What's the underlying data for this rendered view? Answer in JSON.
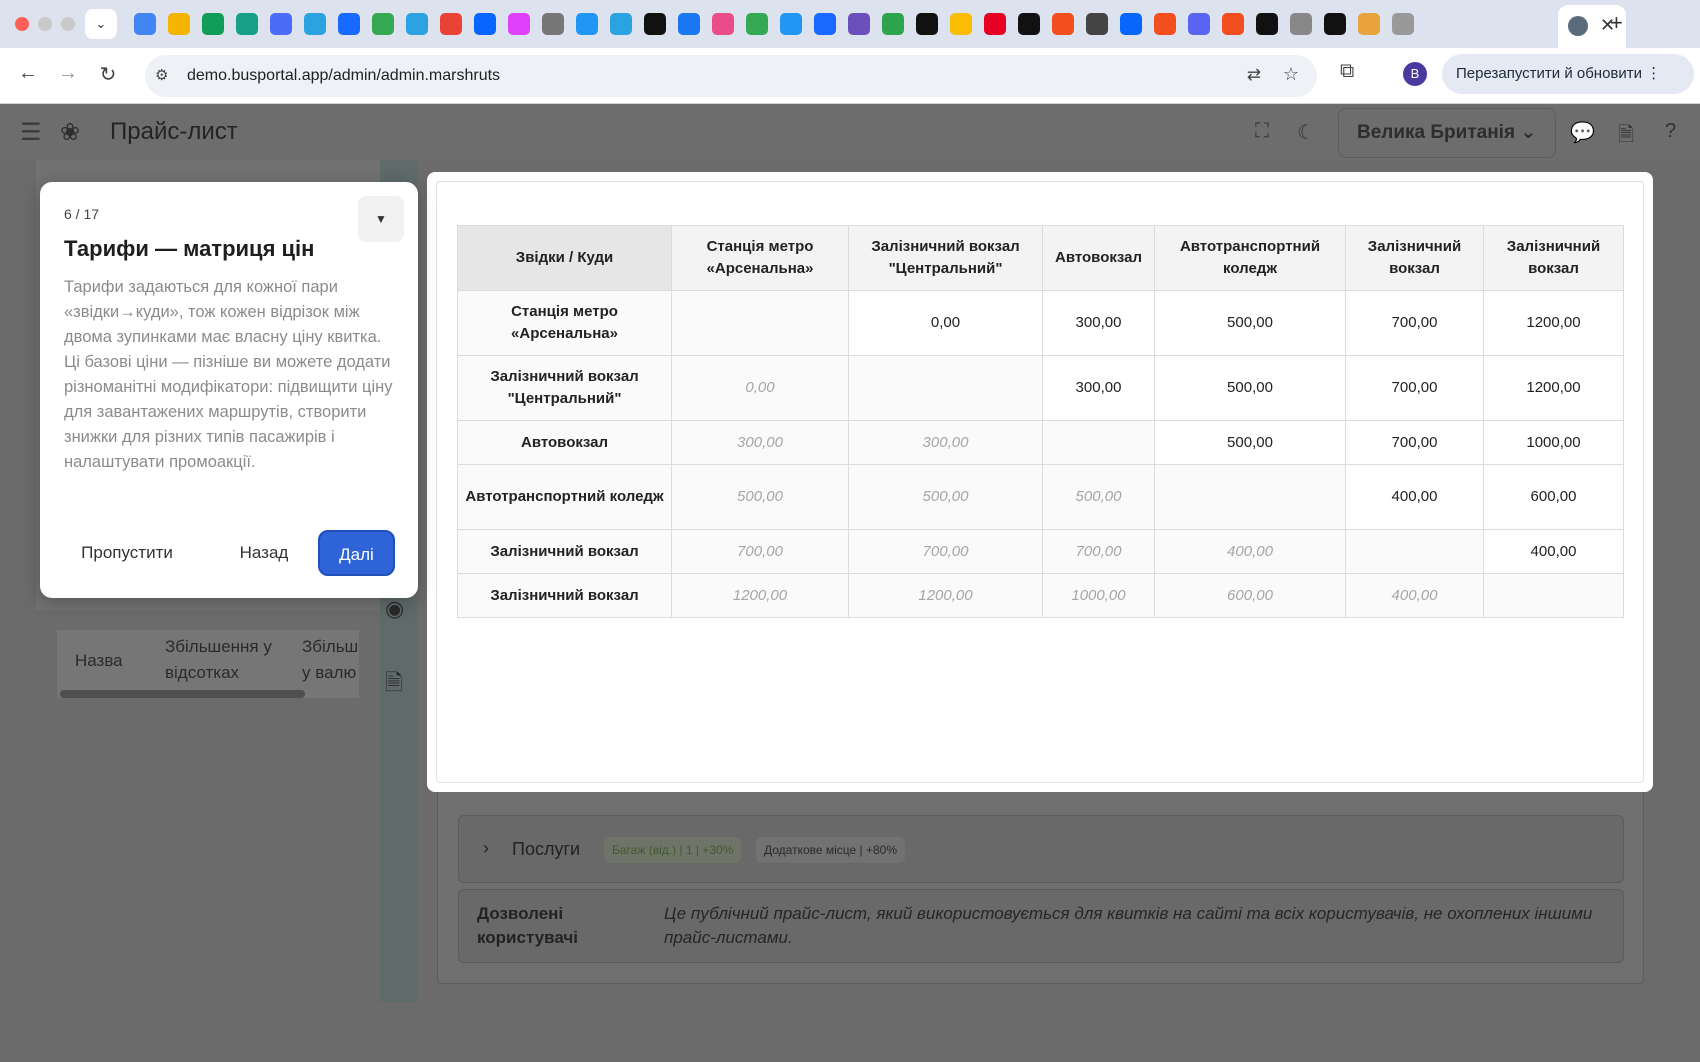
{
  "browser": {
    "url": "demo.busportal.app/admin/admin.marshruts",
    "relaunch_label": "Перезапустити й обновити",
    "profile_initial": "B",
    "tab_dropdown": "⌄",
    "new_tab": "+",
    "close_tab": "✕",
    "favicon_colors": [
      "#4285f4",
      "#f4b400",
      "#0f9d58",
      "#16a085",
      "#4a6cf7",
      "#2aa3e0",
      "#1769ff",
      "#34a853",
      "#2aa3e0",
      "#ea4335",
      "#0866ff",
      "#e040fb",
      "#777777",
      "#2196f3",
      "#2aa3e0",
      "#111111",
      "#1877f2",
      "#ea4c89",
      "#34a853",
      "#2196f3",
      "#1769ff",
      "#6b4fbb",
      "#2ea44f",
      "#111111",
      "#fbbc04",
      "#e60023",
      "#111111",
      "#f24e1e",
      "#444444",
      "#0866ff",
      "#f24e1e",
      "#5865f2",
      "#f24e1e",
      "#111111",
      "#888888",
      "#111111",
      "#e8a33d",
      "#999999"
    ]
  },
  "app": {
    "title": "Прайс-лист",
    "country": "Велика Британія"
  },
  "ghost_table": {
    "col1": "Назва",
    "col2": "Збільшення у відсотках",
    "col3": "Збільш у валю"
  },
  "services": {
    "label": "Послуги",
    "badge_baggage": "Багаж (від.) | 1 | +30%",
    "badge_extra_seat": "Додаткове місце | +80%"
  },
  "allowed_users": {
    "label": "Дозволені користувачі",
    "text": "Це публічний прайс-лист, який використовується для квитків на сайті та всіх користувачів, не охоплених іншими прайс-листами."
  },
  "matrix": {
    "corner": "Звідки / Куди",
    "headers": [
      "Станція метро «Арсенальна»",
      "Залізничний вокзал \"Центральний\"",
      "Автовокзал",
      "Автотранспортний коледж",
      "Залізничний вокзал",
      "Залізничний вокзал"
    ],
    "rows": [
      {
        "from": "Станція метро «Арсенальна»",
        "cells": [
          "",
          "0,00",
          "300,00",
          "500,00",
          "700,00",
          "1200,00"
        ]
      },
      {
        "from": "Залізничний вокзал \"Центральний\"",
        "cells": [
          "0,00",
          "",
          "300,00",
          "500,00",
          "700,00",
          "1200,00"
        ]
      },
      {
        "from": "Автовокзал",
        "cells": [
          "300,00",
          "300,00",
          "",
          "500,00",
          "700,00",
          "1000,00"
        ]
      },
      {
        "from": "Автотранспортний коледж",
        "cells": [
          "500,00",
          "500,00",
          "500,00",
          "",
          "400,00",
          "600,00"
        ]
      },
      {
        "from": "Залізничний вокзал",
        "cells": [
          "700,00",
          "700,00",
          "700,00",
          "400,00",
          "",
          "400,00"
        ]
      },
      {
        "from": "Залізничний вокзал",
        "cells": [
          "1200,00",
          "1200,00",
          "1000,00",
          "600,00",
          "400,00",
          ""
        ]
      }
    ]
  },
  "tour": {
    "step": "6 / 17",
    "collapse_glyph": "▼",
    "title": "Тарифи — матриця цін",
    "description": "Тарифи задаються для кожної пари «звідки→куди», тож кожен відрізок між двома зупинками має власну ціну квитка. Ці базові ціни — пізніше ви можете додати різноманітні модифікатори: підвищити ціну для завантажених маршрутів, створити знижки для різних типів пасажирів і налаштувати промоакції.",
    "skip": "Пропустити",
    "back": "Назад",
    "next": "Далі"
  }
}
